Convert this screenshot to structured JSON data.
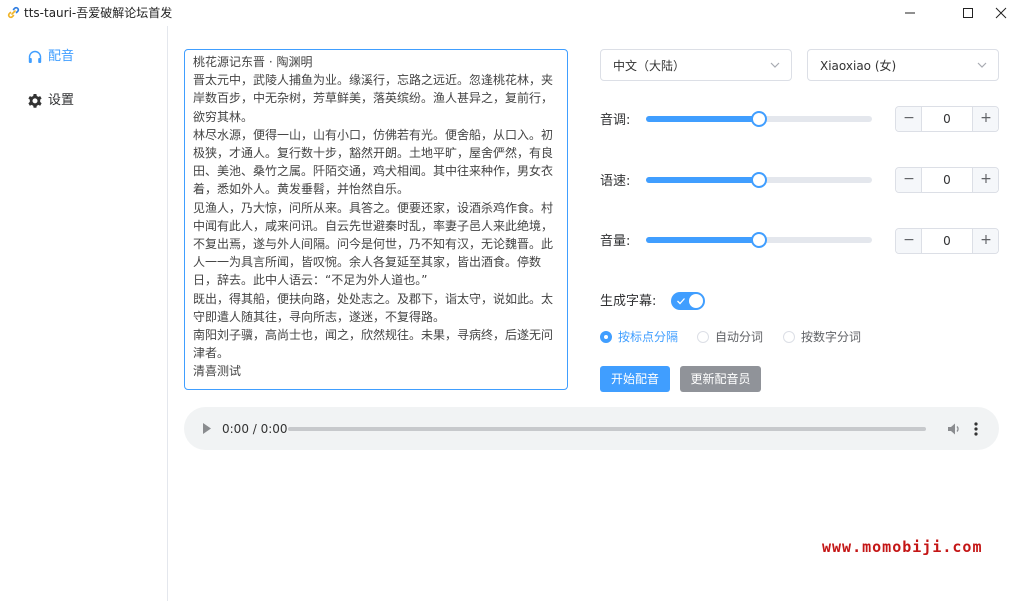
{
  "window": {
    "title": "tts-tauri-吾爱破解论坛首发",
    "icon": "link-icon"
  },
  "sidebar": {
    "items": [
      {
        "label": "配音",
        "icon": "headphones-icon",
        "active": true
      },
      {
        "label": "设置",
        "icon": "gear-icon",
        "active": false
      }
    ]
  },
  "editor": {
    "text": "桃花源记东晋 · 陶渊明\n晋太元中，武陵人捕鱼为业。缘溪行，忘路之远近。忽逢桃花林，夹岸数百步，中无杂树，芳草鲜美，落英缤纷。渔人甚异之，复前行，欲穷其林。\n林尽水源，便得一山，山有小口，仿佛若有光。便舍船，从口入。初极狭，才通人。复行数十步，豁然开朗。土地平旷，屋舍俨然，有良田、美池、桑竹之属。阡陌交通，鸡犬相闻。其中往来种作，男女衣着，悉如外人。黄发垂髫，并怡然自乐。\n见渔人，乃大惊，问所从来。具答之。便要还家，设酒杀鸡作食。村中闻有此人，咸来问讯。自云先世避秦时乱，率妻子邑人来此绝境，不复出焉，遂与外人间隔。问今是何世，乃不知有汉，无论魏晋。此人一一为具言所闻，皆叹惋。余人各复延至其家，皆出酒食。停数日，辞去。此中人语云：“不足为外人道也。”\n既出，得其船，便扶向路，处处志之。及郡下，诣太守，说如此。太守即遣人随其往，寻向所志，遂迷，不复得路。\n南阳刘子骥，高尚士也，闻之，欣然规往。未果，寻病终，后遂无问津者。\n清喜测试"
  },
  "controls": {
    "language_select": "中文（大陆）",
    "voice_select": "Xiaoxiao (女)",
    "pitch": {
      "label": "音调:",
      "value": "0",
      "level": 0.5
    },
    "rate": {
      "label": "语速:",
      "value": "0",
      "level": 0.5
    },
    "volume": {
      "label": "音量:",
      "value": "0",
      "level": 0.5
    },
    "stepper_minus": "−",
    "stepper_plus": "+",
    "subtitle": {
      "label": "生成字幕:",
      "enabled": true
    },
    "split_options": [
      {
        "label": "按标点分隔",
        "checked": true
      },
      {
        "label": "自动分词",
        "checked": false
      },
      {
        "label": "按数字分词",
        "checked": false
      }
    ],
    "start_button": "开始配音",
    "update_button": "更新配音员"
  },
  "player": {
    "time": "0:00 / 0:00"
  },
  "watermark": "www.momobiji.com",
  "colors": {
    "accent": "#409eff",
    "secondary_button": "#909399",
    "watermark": "#c41616"
  }
}
